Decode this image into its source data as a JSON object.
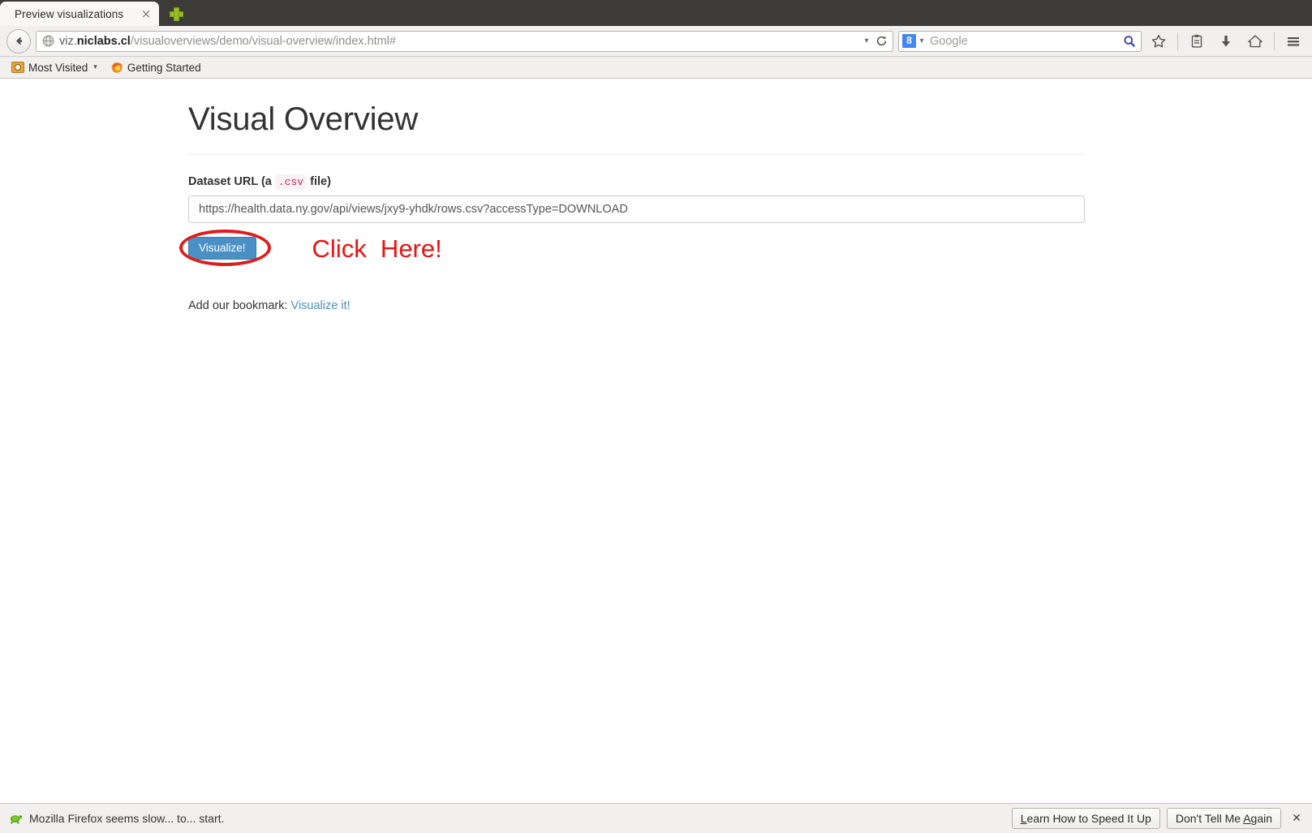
{
  "browser": {
    "tab": {
      "title": "Preview visualizations",
      "close_label": "×",
      "new_tab_label": "+"
    },
    "nav": {
      "back_label": "Back",
      "url_prefix": "viz.",
      "url_host": "niclabs.cl",
      "url_path": "/visualoverviews/demo/visual-overview/index.html#",
      "url_full": "viz.niclabs.cl/visualoverviews/demo/visual-overview/index.html#",
      "dropdown_caret": "▾",
      "reload_label": "Reload",
      "identity_icon": "globe-icon"
    },
    "search": {
      "engine": "Google",
      "engine_glyph": "8",
      "placeholder": "Google",
      "caret": "▾",
      "go_label": "Search"
    },
    "toolbar_icons": [
      {
        "name": "bookmark-star-icon",
        "label": "Bookmark this page"
      },
      {
        "name": "reading-list-icon",
        "label": "Reading list"
      },
      {
        "name": "downloads-icon",
        "label": "Downloads"
      },
      {
        "name": "home-icon",
        "label": "Home"
      },
      {
        "name": "menu-icon",
        "label": "Open menu"
      }
    ],
    "bookmarks": [
      {
        "label": "Most Visited",
        "icon": "most-visited-folder-icon",
        "caret": "▾"
      },
      {
        "label": "Getting Started",
        "icon": "firefox-icon",
        "caret": ""
      }
    ]
  },
  "page": {
    "title": "Visual Overview",
    "form": {
      "label_prefix": "Dataset URL (a",
      "label_code": ".csv",
      "label_suffix": "file)",
      "url_value": "https://health.data.ny.gov/api/views/jxy9-yhdk/rows.csv?accessType=DOWNLOAD",
      "url_placeholder": "Dataset URL",
      "submit_label": "Visualize!"
    },
    "annotation": {
      "text": "Click  Here!",
      "color": "#ee1111",
      "shape": "ellipse-highlight"
    },
    "bookmark_prompt": {
      "text": "Add our bookmark:",
      "link_label": "Visualize it!",
      "link_color": "#4a90c4"
    }
  },
  "notification": {
    "icon": "turtle-icon",
    "message": "Mozilla Firefox seems slow... to... start.",
    "primary_button": {
      "pre": "L",
      "post": "earn How to Speed It Up"
    },
    "secondary_button": {
      "pre": "Don't Tell Me ",
      "accel": "A",
      "post": "gain"
    },
    "close_label": "✕"
  }
}
